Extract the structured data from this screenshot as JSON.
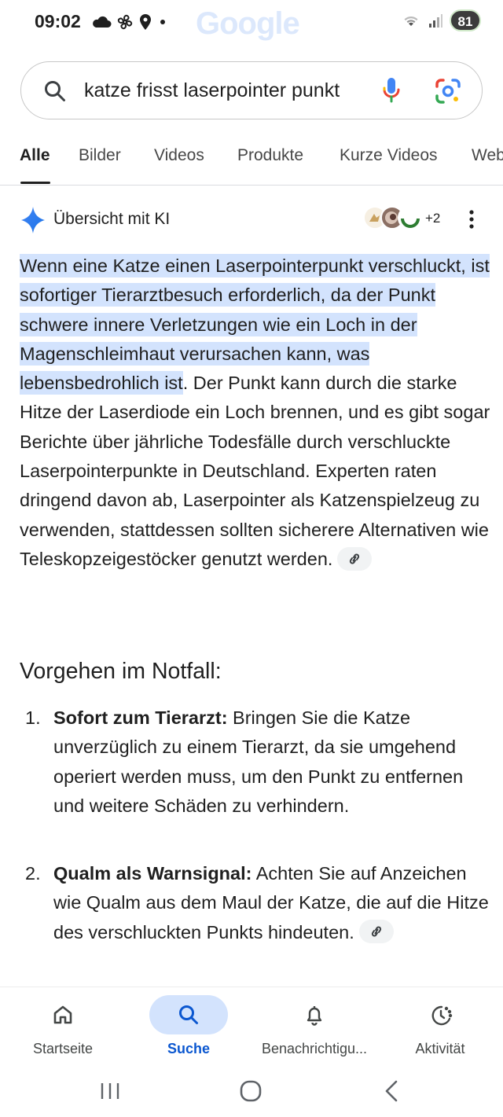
{
  "status_bar": {
    "time": "09:02",
    "battery": "81",
    "watermark": "Google"
  },
  "search": {
    "query": "katze frisst laserpointer punkt"
  },
  "tabs": [
    {
      "label": "Alle",
      "active": true
    },
    {
      "label": "Bilder"
    },
    {
      "label": "Videos"
    },
    {
      "label": "Produkte"
    },
    {
      "label": "Kurze Videos"
    },
    {
      "label": "Web"
    }
  ],
  "ai_overview": {
    "title": "Übersicht mit KI",
    "source_count": "+2",
    "highlight_text": "Wenn eine Katze einen Laserpointerpunkt verschluckt, ist sofortiger Tierarztbesuch erforderlich, da der Punkt schwere innere Verletzungen wie ein Loch in der Magenschleimhaut verursachen kann, was lebensbedrohlich ist",
    "body_text": ". Der Punkt kann durch die starke Hitze der Laserdiode ein Loch brennen, und es gibt sogar Berichte über jährliche Todesfälle durch verschluckte Laserpointerpunkte in Deutschland. Experten raten dringend davon ab, Laserpointer als Katzenspielzeug zu verwenden, stattdessen sollten sicherere Alternativen wie Teleskopzeigestöcker genutzt werden.",
    "section_heading": "Vorgehen im Notfall:",
    "steps": [
      {
        "number": "1.",
        "title": "Sofort zum Tierarzt:",
        "text": " Bringen Sie die Katze unverzüglich zu einem Tierarzt, da sie umgehend operiert werden muss, um den Punkt zu entfernen und weitere Schäden zu verhindern."
      },
      {
        "number": "2.",
        "title": "Qualm als Warnsignal:",
        "text": " Achten Sie auf Anzeichen wie Qualm aus dem Maul der Katze, die auf die Hitze des verschluckten Punkts hindeuten."
      }
    ]
  },
  "bottom_nav": [
    {
      "label": "Startseite",
      "icon": "home-icon"
    },
    {
      "label": "Suche",
      "icon": "search-icon",
      "active": true
    },
    {
      "label": "Benachrichtigu...",
      "icon": "bell-icon"
    },
    {
      "label": "Aktivität",
      "icon": "activity-icon"
    }
  ],
  "colors": {
    "highlight": "#d3e3fd",
    "accent_blue": "#0b57d0"
  }
}
